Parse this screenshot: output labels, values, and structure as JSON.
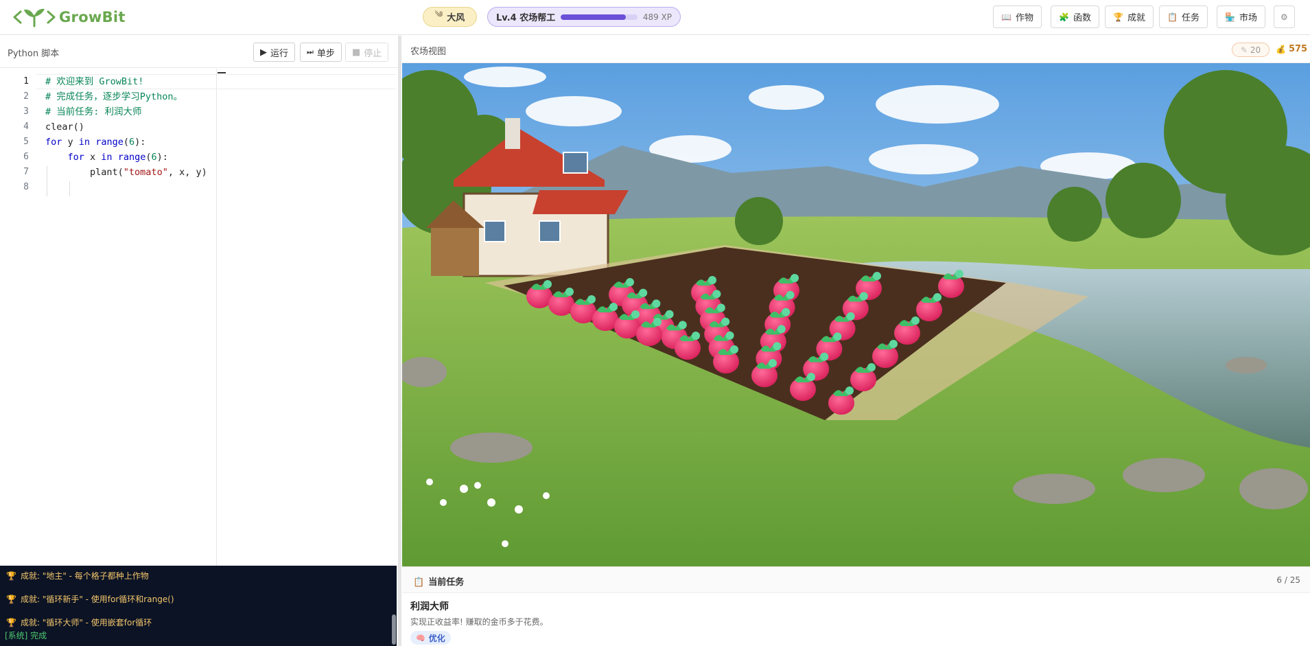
{
  "app": {
    "name": "GrowBit"
  },
  "header": {
    "weather": {
      "label": "大风",
      "icon": "wind-icon"
    },
    "level": {
      "label": "Lv.4 农场帮工",
      "xp_text": "489 XP",
      "progress": 0.85
    },
    "nav": [
      {
        "label": "作物",
        "icon": "book-icon"
      },
      {
        "label": "函数",
        "icon": "blocks-icon"
      },
      {
        "label": "成就",
        "icon": "trophy-icon"
      },
      {
        "label": "任务",
        "icon": "clipboard-icon"
      },
      {
        "label": "市场",
        "icon": "market-icon"
      }
    ],
    "settings_icon": "gear-icon"
  },
  "editor": {
    "title": "Python 脚本",
    "run_label": "运行",
    "step_label": "单步",
    "stop_label": "停止",
    "lines": [
      {
        "n": "1",
        "tokens": [
          {
            "t": "# 欢迎来到 GrowBit!",
            "c": "comment"
          }
        ]
      },
      {
        "n": "2",
        "tokens": [
          {
            "t": "# 完成任务，逐步学习Python。",
            "c": "comment"
          }
        ]
      },
      {
        "n": "3",
        "tokens": [
          {
            "t": "# 当前任务: 利润大师",
            "c": "comment"
          }
        ]
      },
      {
        "n": "4",
        "tokens": [
          {
            "t": "clear()",
            "c": ""
          }
        ]
      },
      {
        "n": "5",
        "tokens": [
          {
            "t": "for",
            "c": "kw"
          },
          {
            "t": " y ",
            "c": ""
          },
          {
            "t": "in",
            "c": "kw"
          },
          {
            "t": " ",
            "c": ""
          },
          {
            "t": "range",
            "c": "kw"
          },
          {
            "t": "(",
            "c": ""
          },
          {
            "t": "6",
            "c": "num"
          },
          {
            "t": "):",
            "c": ""
          }
        ]
      },
      {
        "n": "6",
        "tokens": [
          {
            "t": "    ",
            "c": ""
          },
          {
            "t": "for",
            "c": "kw"
          },
          {
            "t": " x ",
            "c": ""
          },
          {
            "t": "in",
            "c": "kw"
          },
          {
            "t": " ",
            "c": ""
          },
          {
            "t": "range",
            "c": "kw"
          },
          {
            "t": "(",
            "c": ""
          },
          {
            "t": "6",
            "c": "num"
          },
          {
            "t": "):",
            "c": ""
          }
        ]
      },
      {
        "n": "7",
        "tokens": [
          {
            "t": "        plant(",
            "c": ""
          },
          {
            "t": "\"tomato\"",
            "c": "str"
          },
          {
            "t": ", x, y)",
            "c": ""
          }
        ]
      },
      {
        "n": "8",
        "tokens": []
      }
    ]
  },
  "console": {
    "lines": [
      {
        "text": "成就: \"地主\" - 每个格子都种上作物",
        "type": "achievement"
      },
      {
        "text": "成就: \"循环新手\" - 使用for循环和range()",
        "type": "achievement"
      },
      {
        "text": "成就: \"循环大师\" - 使用嵌套for循环",
        "type": "achievement"
      },
      {
        "text": "[系统] 完成",
        "type": "system"
      }
    ]
  },
  "farm": {
    "title": "农场视图",
    "energy": "20",
    "gold": "575",
    "crop": "tomato",
    "grid_size": 6,
    "crop_count": 36
  },
  "task": {
    "heading": "当前任务",
    "progress": "6 / 25",
    "name": "利润大师",
    "description": "实现正收益率! 赚取的金币多于花费。",
    "tag": "优化"
  },
  "colors": {
    "accent_green": "#6aa84f",
    "xp_purple": "#6b4fd8",
    "console_bg": "#0b1325",
    "achievement_text": "#f3c56b",
    "system_text": "#4ec970",
    "tomato": "#e8336e"
  }
}
